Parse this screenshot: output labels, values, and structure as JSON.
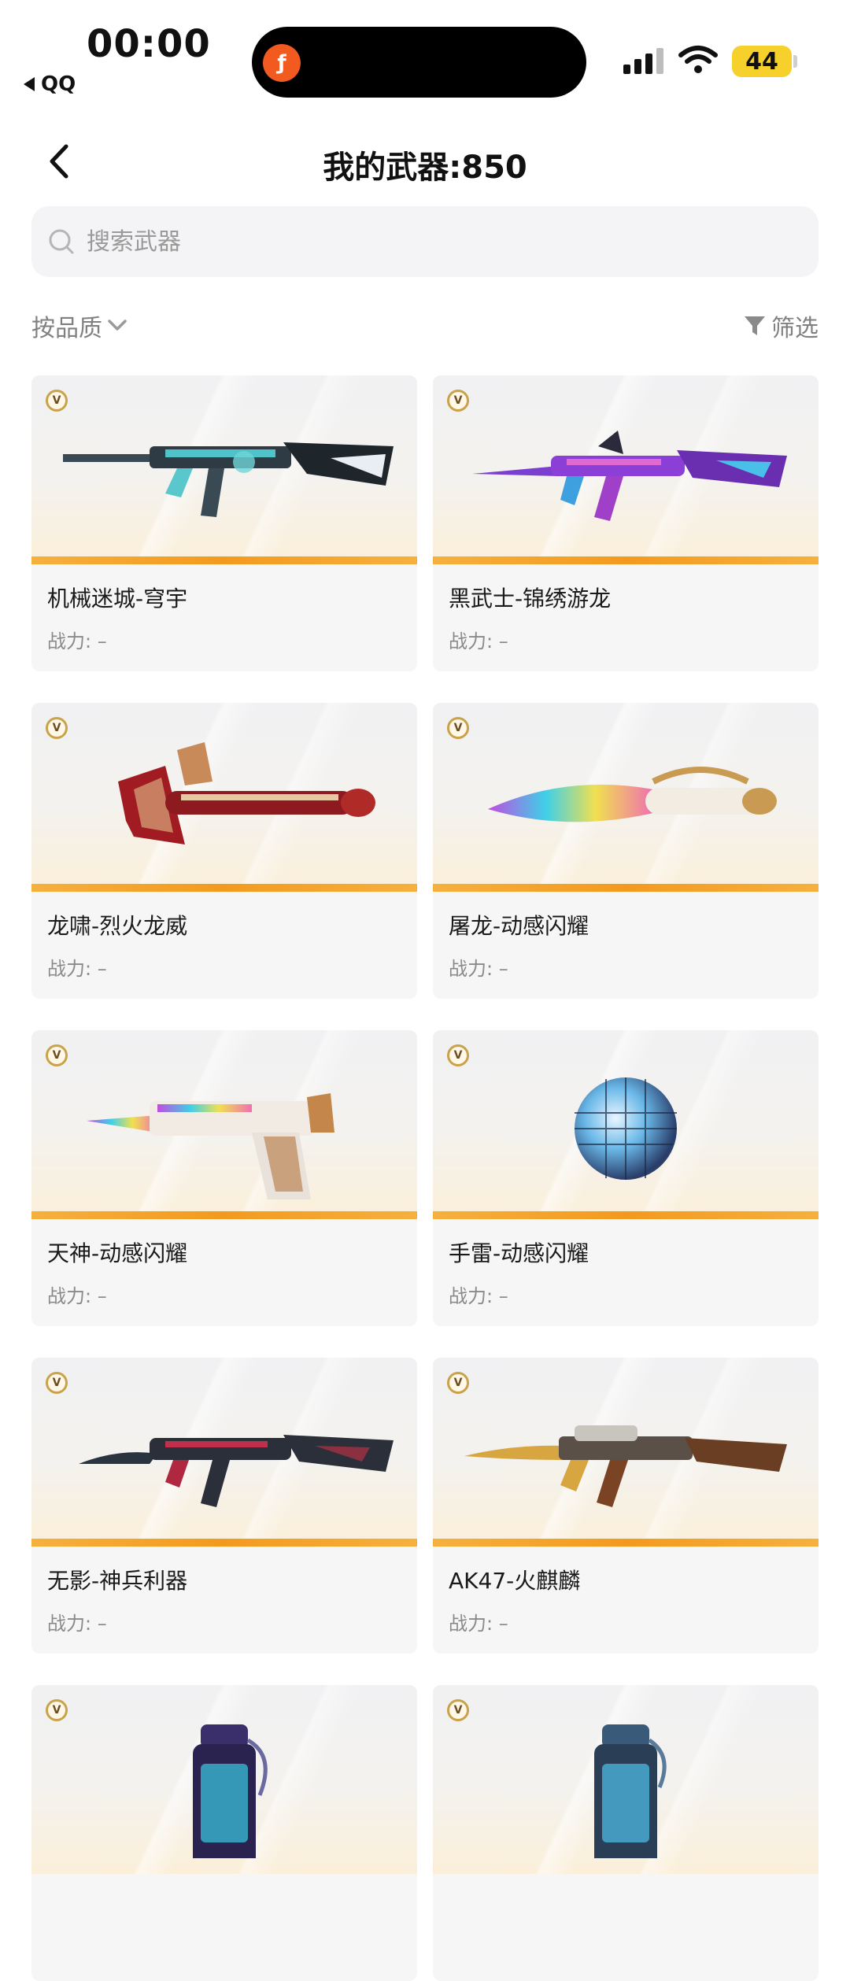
{
  "status_bar": {
    "time": "00:00",
    "back_app": "QQ",
    "battery": "44"
  },
  "nav": {
    "title": "我的武器:850"
  },
  "search": {
    "placeholder": "搜索武器"
  },
  "filters": {
    "sort_label": "按品质",
    "filter_label": "筛选"
  },
  "colors": {
    "accent_stripe": "#f39a1e",
    "card_bg": "#f6f6f7",
    "battery": "#f6d02b"
  },
  "weapons": [
    {
      "name": "机械迷城-穹宇",
      "power": "战力: –",
      "badge": "V",
      "icon": "rifle-icon"
    },
    {
      "name": "黑武士-锦绣游龙",
      "power": "战力: –",
      "badge": "V",
      "icon": "rifle-icon"
    },
    {
      "name": "龙啸-烈火龙威",
      "power": "战力: –",
      "badge": "V",
      "icon": "axe-icon"
    },
    {
      "name": "屠龙-动感闪耀",
      "power": "战力: –",
      "badge": "V",
      "icon": "knife-icon"
    },
    {
      "name": "天神-动感闪耀",
      "power": "战力: –",
      "badge": "V",
      "icon": "pistol-icon"
    },
    {
      "name": "手雷-动感闪耀",
      "power": "战力: –",
      "badge": "V",
      "icon": "grenade-icon"
    },
    {
      "name": "无影-神兵利器",
      "power": "战力: –",
      "badge": "V",
      "icon": "rifle-icon"
    },
    {
      "name": "AK47-火麒麟",
      "power": "战力: –",
      "badge": "V",
      "icon": "rifle-icon"
    },
    {
      "name": "",
      "power": "",
      "badge": "V",
      "icon": "grenade-icon"
    },
    {
      "name": "",
      "power": "",
      "badge": "V",
      "icon": "grenade-icon"
    }
  ]
}
